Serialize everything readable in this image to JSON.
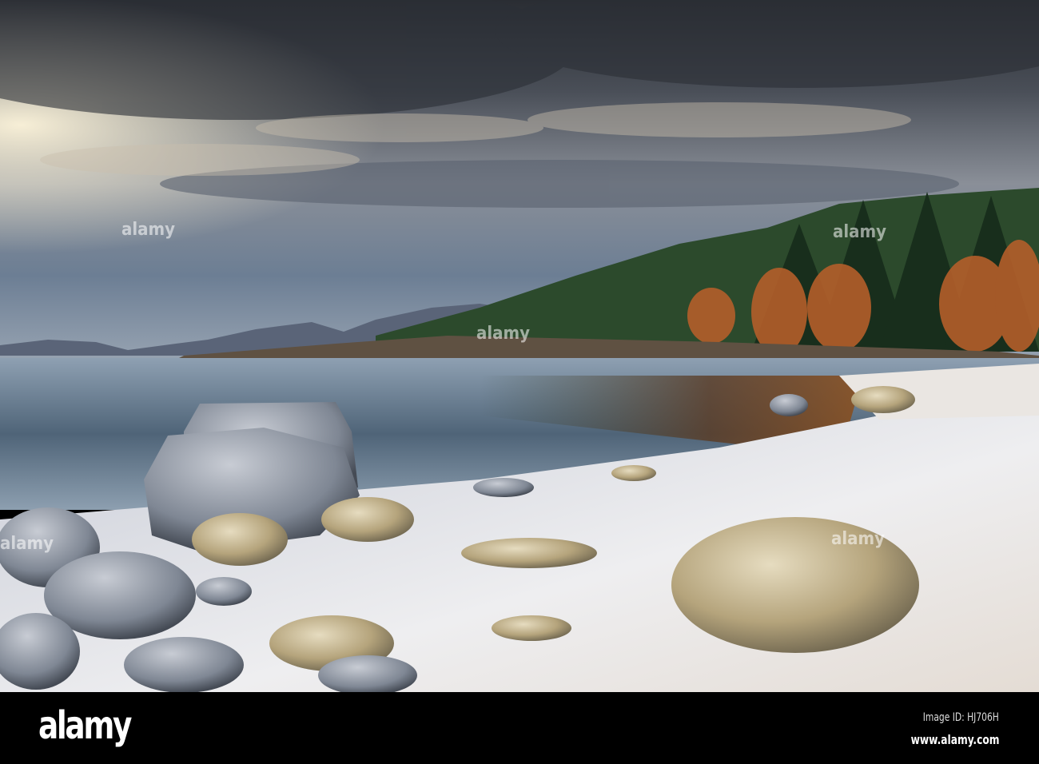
{
  "photo": {
    "subject": "Frosty loch shore with boulders, forested hillside and cloudy sky",
    "colors": {
      "sky_dark": "#2e3440",
      "sky_light": "#b9bcc0",
      "water": "#5d7487",
      "snow": "#e6e6ea",
      "trees": "#1f3a22",
      "birch": "#b0602c",
      "rock": "#b9ac90"
    }
  },
  "watermark": {
    "text": "alamy"
  },
  "footer": {
    "logo": "alamy",
    "image_id": "Image ID: HJ706H",
    "url": "www.alamy.com"
  }
}
